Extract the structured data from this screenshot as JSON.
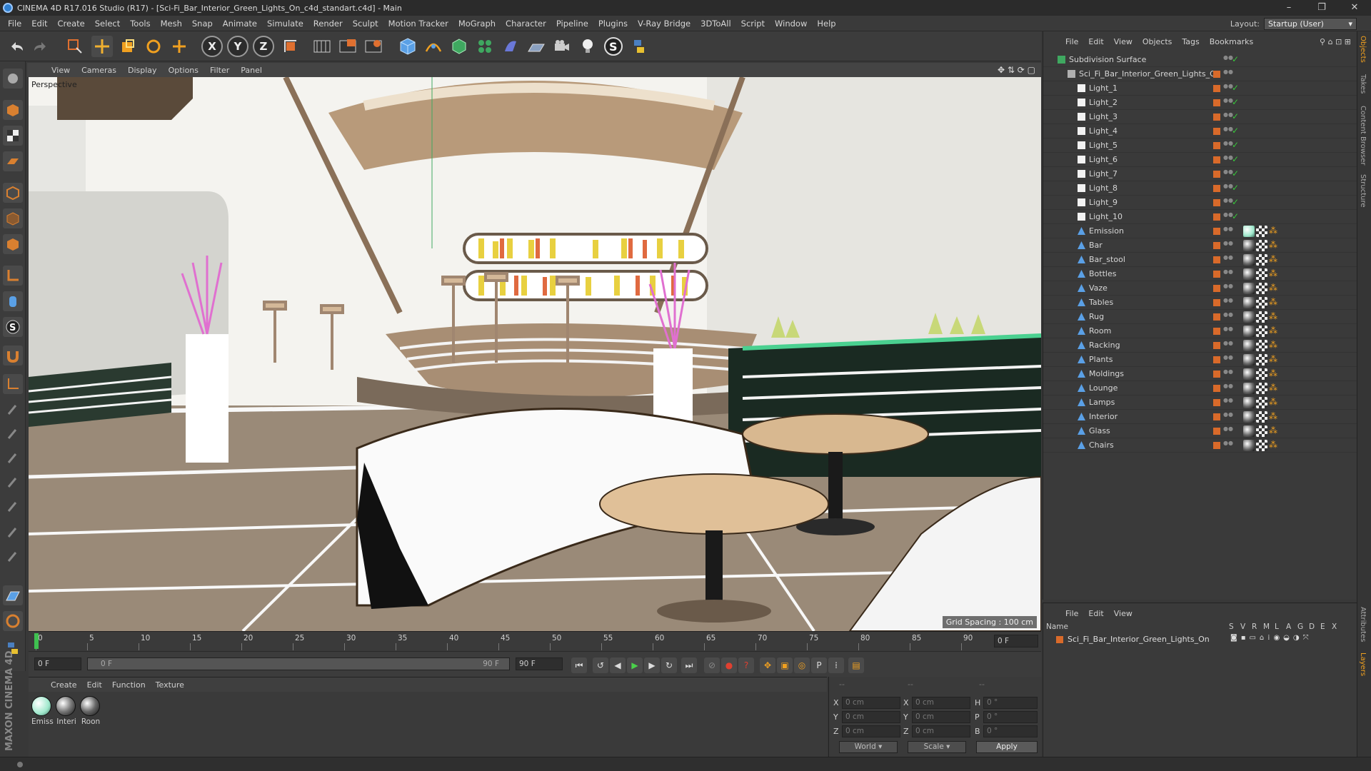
{
  "app": {
    "title": "CINEMA 4D R17.016 Studio (R17) - [Sci-Fi_Bar_Interior_Green_Lights_On_c4d_standart.c4d] - Main",
    "layout_label": "Layout:",
    "layout_value": "Startup (User)",
    "window_controls": [
      "–",
      "❐",
      "✕"
    ]
  },
  "menu": [
    "File",
    "Edit",
    "Create",
    "Select",
    "Tools",
    "Mesh",
    "Snap",
    "Animate",
    "Simulate",
    "Render",
    "Sculpt",
    "Motion Tracker",
    "MoGraph",
    "Character",
    "Pipeline",
    "Plugins",
    "V-Ray Bridge",
    "3DToAll",
    "Script",
    "Window",
    "Help"
  ],
  "toolbar": {
    "axis_x": "X",
    "axis_y": "Y",
    "axis_z": "Z"
  },
  "viewport": {
    "menu": [
      "View",
      "Cameras",
      "Display",
      "Options",
      "Filter",
      "Panel"
    ],
    "label": "Perspective",
    "grid_spacing": "Grid Spacing : 100 cm"
  },
  "timeline": {
    "ticks": [
      "0",
      "5",
      "10",
      "15",
      "20",
      "25",
      "30",
      "35",
      "40",
      "45",
      "50",
      "55",
      "60",
      "65",
      "70",
      "75",
      "80",
      "85",
      "90"
    ],
    "current_frame": "0 F",
    "start_field": "0 F",
    "range_start": "0 F",
    "range_end": "90 F",
    "end_field": "90 F"
  },
  "materials": {
    "menu": [
      "Create",
      "Edit",
      "Function",
      "Texture"
    ],
    "items": [
      {
        "name": "Emiss",
        "color": "#bff5e2"
      },
      {
        "name": "Interi",
        "color": "#e8e8e8"
      },
      {
        "name": "Roon",
        "color": "#d0d0d0"
      }
    ]
  },
  "coords": {
    "header_left": "--",
    "header_mid": "--",
    "header_right": "--",
    "rows": [
      {
        "a": "X",
        "av": "0 cm",
        "b": "X",
        "bv": "0 cm",
        "c": "H",
        "cv": "0 °"
      },
      {
        "a": "Y",
        "av": "0 cm",
        "b": "Y",
        "bv": "0 cm",
        "c": "P",
        "cv": "0 °"
      },
      {
        "a": "Z",
        "av": "0 cm",
        "b": "Z",
        "bv": "0 cm",
        "c": "B",
        "cv": "0 °"
      }
    ],
    "world": "World",
    "scale": "Scale",
    "apply": "Apply"
  },
  "brand": "MAXON CINEMA 4D",
  "objects": {
    "menu": [
      "File",
      "Edit",
      "View",
      "Objects",
      "Tags",
      "Bookmarks"
    ],
    "items": [
      {
        "name": "Subdivision Surface",
        "depth": 0,
        "kind": "subd"
      },
      {
        "name": "Sci_Fi_Bar_Interior_Green_Lights_On",
        "depth": 1,
        "kind": "null"
      },
      {
        "name": "Light_1",
        "depth": 2,
        "kind": "light"
      },
      {
        "name": "Light_2",
        "depth": 2,
        "kind": "light"
      },
      {
        "name": "Light_3",
        "depth": 2,
        "kind": "light"
      },
      {
        "name": "Light_4",
        "depth": 2,
        "kind": "light"
      },
      {
        "name": "Light_5",
        "depth": 2,
        "kind": "light"
      },
      {
        "name": "Light_6",
        "depth": 2,
        "kind": "light"
      },
      {
        "name": "Light_7",
        "depth": 2,
        "kind": "light"
      },
      {
        "name": "Light_8",
        "depth": 2,
        "kind": "light"
      },
      {
        "name": "Light_9",
        "depth": 2,
        "kind": "light"
      },
      {
        "name": "Light_10",
        "depth": 2,
        "kind": "light"
      },
      {
        "name": "Emission",
        "depth": 2,
        "kind": "poly"
      },
      {
        "name": "Bar",
        "depth": 2,
        "kind": "poly"
      },
      {
        "name": "Bar_stool",
        "depth": 2,
        "kind": "poly"
      },
      {
        "name": "Bottles",
        "depth": 2,
        "kind": "poly"
      },
      {
        "name": "Vaze",
        "depth": 2,
        "kind": "poly"
      },
      {
        "name": "Tables",
        "depth": 2,
        "kind": "poly"
      },
      {
        "name": "Rug",
        "depth": 2,
        "kind": "poly"
      },
      {
        "name": "Room",
        "depth": 2,
        "kind": "poly"
      },
      {
        "name": "Racking",
        "depth": 2,
        "kind": "poly"
      },
      {
        "name": "Plants",
        "depth": 2,
        "kind": "poly"
      },
      {
        "name": "Moldings",
        "depth": 2,
        "kind": "poly"
      },
      {
        "name": "Lounge",
        "depth": 2,
        "kind": "poly"
      },
      {
        "name": "Lamps",
        "depth": 2,
        "kind": "poly"
      },
      {
        "name": "Interior",
        "depth": 2,
        "kind": "poly"
      },
      {
        "name": "Glass",
        "depth": 2,
        "kind": "poly"
      },
      {
        "name": "Chairs",
        "depth": 2,
        "kind": "poly"
      }
    ]
  },
  "layers": {
    "menu": [
      "File",
      "Edit",
      "View"
    ],
    "columns": [
      "Name",
      "S",
      "V",
      "R",
      "M",
      "L",
      "A",
      "G",
      "D",
      "E",
      "X"
    ],
    "row": "Sci_Fi_Bar_Interior_Green_Lights_On"
  },
  "side_tabs": [
    "Objects",
    "Takes",
    "Content Browser",
    "Structure",
    "Attributes",
    "Layers"
  ],
  "colors": {
    "accent_orange": "#d96a2a",
    "check_green": "#37c53a",
    "object_blue": "#5aa0e6"
  }
}
